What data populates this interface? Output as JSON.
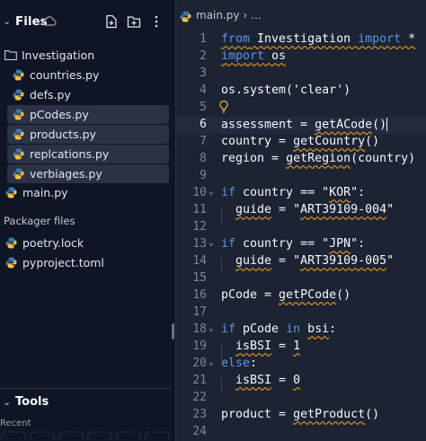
{
  "sidebar": {
    "title": "Files",
    "folder": "Investigation",
    "items": [
      {
        "label": "countries.py",
        "selected": false
      },
      {
        "label": "defs.py",
        "selected": false
      },
      {
        "label": "pCodes.py",
        "selected": true
      },
      {
        "label": "products.py",
        "selected": true
      },
      {
        "label": "replcations.py",
        "selected": true
      },
      {
        "label": "verbiages.py",
        "selected": true
      }
    ],
    "root_file": "main.py",
    "packager_label": "Packager files",
    "packager_items": [
      {
        "label": "poetry.lock"
      },
      {
        "label": "pyproject.toml"
      }
    ],
    "tools_label": "Tools",
    "recent_label": "Recent"
  },
  "editor": {
    "tab_name": "main.py",
    "breadcrumb_more": "…",
    "active_line": 6,
    "lines": [
      {
        "n": "1",
        "text": "from Investigation import *"
      },
      {
        "n": "2",
        "text": "import os"
      },
      {
        "n": "3",
        "text": ""
      },
      {
        "n": "4",
        "text": "os.system('clear')"
      },
      {
        "n": "5",
        "text": ""
      },
      {
        "n": "6",
        "text": "assessment = getACode()"
      },
      {
        "n": "7",
        "text": "country = getCountry()"
      },
      {
        "n": "8",
        "text": "region = getRegion(country)"
      },
      {
        "n": "9",
        "text": ""
      },
      {
        "n": "10",
        "text": "if country == \"KOR\":"
      },
      {
        "n": "11",
        "text": "  guide = \"ART39109-004\""
      },
      {
        "n": "12",
        "text": ""
      },
      {
        "n": "13",
        "text": "if country == \"JPN\":"
      },
      {
        "n": "14",
        "text": "  guide = \"ART39109-005\""
      },
      {
        "n": "15",
        "text": ""
      },
      {
        "n": "16",
        "text": "pCode = getPCode()"
      },
      {
        "n": "17",
        "text": ""
      },
      {
        "n": "18",
        "text": "if pCode in bsi:"
      },
      {
        "n": "19",
        "text": "  isBSI = 1"
      },
      {
        "n": "20",
        "text": "else:"
      },
      {
        "n": "21",
        "text": "  isBSI = 0"
      },
      {
        "n": "22",
        "text": ""
      },
      {
        "n": "23",
        "text": "product = getProduct()"
      },
      {
        "n": "24",
        "text": ""
      }
    ]
  },
  "colors": {
    "sidebar_bg": "#0e1525",
    "editor_bg": "#1c2333",
    "keyword": "#5a96e2",
    "warning_squiggle": "#c7871e",
    "python_blue": "#3c78aa",
    "python_yellow": "#f5c242"
  },
  "icons": [
    "chevron-down-icon",
    "cloud-icon",
    "new-file-icon",
    "new-folder-icon",
    "more-options-icon",
    "folder-icon",
    "python-file-icon",
    "lightbulb-icon",
    "fold-chevron-icon"
  ]
}
